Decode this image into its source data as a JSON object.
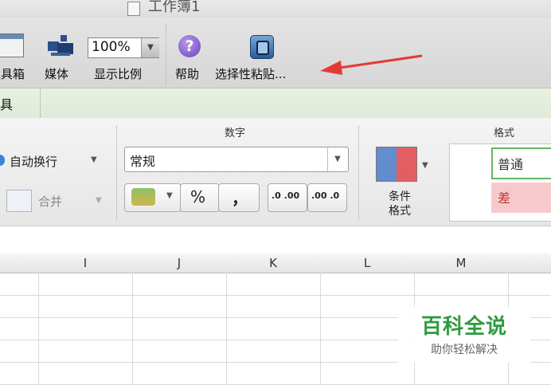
{
  "window": {
    "title": "工作簿1"
  },
  "toolbar": {
    "items": [
      {
        "label": "工具箱",
        "icon": "toolbox-icon"
      },
      {
        "label": "媒体",
        "icon": "media-icon"
      },
      {
        "label": "显示比例",
        "icon": "zoom-icon"
      },
      {
        "label": "帮助",
        "icon": "help-icon"
      },
      {
        "label": "选择性粘贴...",
        "icon": "paste-special-icon"
      }
    ],
    "zoom_value": "100%"
  },
  "ribbon": {
    "tab_label": "具",
    "groups": {
      "number": {
        "title": "数字",
        "format_value": "常规",
        "percent": "%",
        "comma": "，",
        "inc_decimal": ".0 .00",
        "dec_decimal": ".00 .0"
      },
      "format": {
        "title": "格式",
        "cond_label_1": "条件",
        "cond_label_2": "格式",
        "style_normal": "普通",
        "style_bad": "差"
      },
      "alignment": {
        "wrap_text": "自动换行",
        "merge": "合并"
      }
    }
  },
  "sheet": {
    "columns": [
      "I",
      "J",
      "K",
      "L",
      "M"
    ]
  },
  "watermark": {
    "title": "百科全说",
    "subtitle": "助你轻松解决"
  },
  "colors": {
    "accent_arrow": "#e53935",
    "ribbon_green": "#e3eedc",
    "watermark_green": "#2e9b3f"
  }
}
